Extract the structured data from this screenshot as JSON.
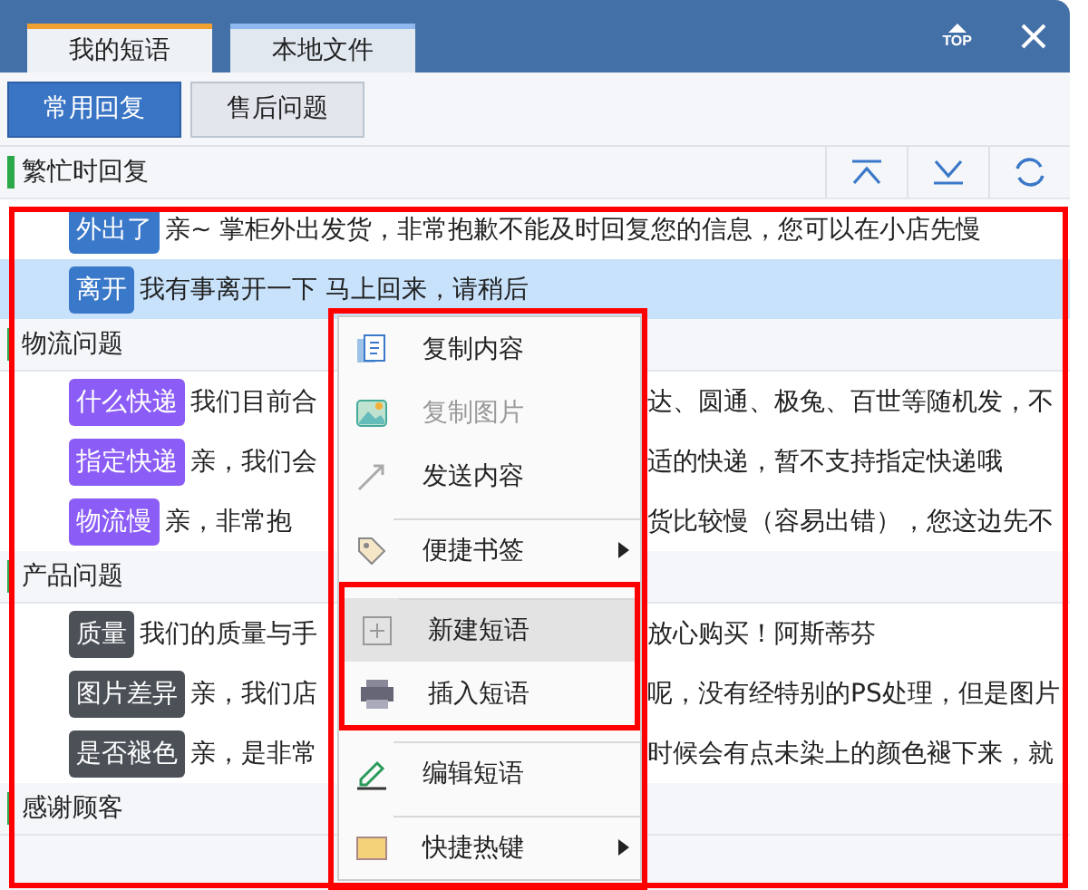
{
  "tabs": [
    {
      "label": "我的短语",
      "selected": true
    },
    {
      "label": "本地文件",
      "selected": false
    }
  ],
  "header": {
    "top_label": "TOP"
  },
  "subtabs": [
    {
      "label": "常用回复",
      "selected": true
    },
    {
      "label": "售后问题",
      "selected": false
    }
  ],
  "groups": [
    {
      "title": "繁忙时回复",
      "rows": [
        {
          "tag": "外出了",
          "color": "#3a78c9",
          "text": "亲~ 掌柜外出发货，非常抱歉不能及时回复您的信息，您可以在小店先慢",
          "selected": false
        },
        {
          "tag": "离开",
          "color": "#3a78c9",
          "text": "我有事离开一下 马上回来，请稍后",
          "selected": true
        }
      ]
    },
    {
      "title": "物流问题",
      "rows": [
        {
          "tag": "什么快递",
          "color": "#8b5cf6",
          "text": "我们目前合",
          "text_after": "达、圆通、极兔、百世等随机发，不",
          "selected": false
        },
        {
          "tag": "指定快递",
          "color": "#8b5cf6",
          "text": "亲，我们会",
          "text_after": "适的快递，暂不支持指定快递哦",
          "selected": false
        },
        {
          "tag": "物流慢",
          "color": "#8b5cf6",
          "text": "亲，非常抱",
          "text_after": "货比较慢（容易出错），您这边先不",
          "selected": false
        }
      ]
    },
    {
      "title": "产品问题",
      "rows": [
        {
          "tag": "质量",
          "color": "#4b5157",
          "text": "我们的质量与手",
          "text_after": "放心购买！阿斯蒂芬",
          "selected": false
        },
        {
          "tag": "图片差异",
          "color": "#4b5157",
          "text": "亲，我们店",
          "text_after": "呢，没有经特别的PS处理，但是图片",
          "selected": false
        },
        {
          "tag": "是否褪色",
          "color": "#4b5157",
          "text": "亲，是非常",
          "text_after": "时候会有点未染上的颜色褪下来，就",
          "selected": false
        }
      ]
    },
    {
      "title": "感谢顾客"
    }
  ],
  "context_menu": {
    "sections": [
      {
        "annotated": false,
        "items": [
          {
            "label": "复制内容",
            "disabled": false,
            "selected": false,
            "submenu": false,
            "separator_before": false
          },
          {
            "label": "复制图片",
            "disabled": true,
            "selected": false,
            "submenu": false,
            "separator_before": false
          },
          {
            "label": "发送内容",
            "disabled": false,
            "selected": false,
            "submenu": false,
            "separator_before": false
          },
          {
            "label": "便捷书签",
            "disabled": false,
            "selected": false,
            "submenu": true,
            "separator_before": true
          }
        ]
      },
      {
        "annotated": true,
        "items": [
          {
            "label": "新建短语",
            "disabled": false,
            "selected": true,
            "submenu": false,
            "separator_before": true
          },
          {
            "label": "插入短语",
            "disabled": false,
            "selected": false,
            "submenu": false,
            "separator_before": false
          }
        ]
      },
      {
        "annotated": false,
        "items": [
          {
            "label": "编辑短语",
            "disabled": false,
            "selected": false,
            "submenu": false,
            "separator_before": true
          },
          {
            "label": "快捷热键",
            "disabled": false,
            "selected": false,
            "submenu": true,
            "separator_before": true
          }
        ]
      }
    ]
  }
}
